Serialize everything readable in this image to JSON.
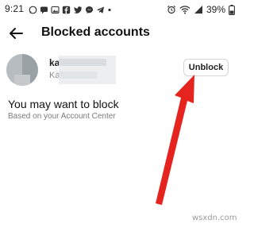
{
  "status_bar": {
    "time": "9:21",
    "battery": "39%",
    "notification_icons": [
      "whatsapp-icon",
      "chat-icon",
      "image-icon",
      "facebook-icon",
      "twitter-icon",
      "messenger-icon",
      "telegram-icon",
      "more-dot-icon"
    ],
    "system_icons": [
      "alarm-icon",
      "wifi-icon",
      "signal-icon",
      "battery-icon"
    ]
  },
  "header": {
    "title": "Blocked accounts"
  },
  "blocked_account": {
    "name": "ka",
    "subtitle": "Ka",
    "unblock_label": "Unblock"
  },
  "suggestions": {
    "title": "You may want to block",
    "subtitle": "Based on your Account Center"
  },
  "annotation": {
    "color": "#e5241f"
  },
  "watermark": "wsxdn.com"
}
